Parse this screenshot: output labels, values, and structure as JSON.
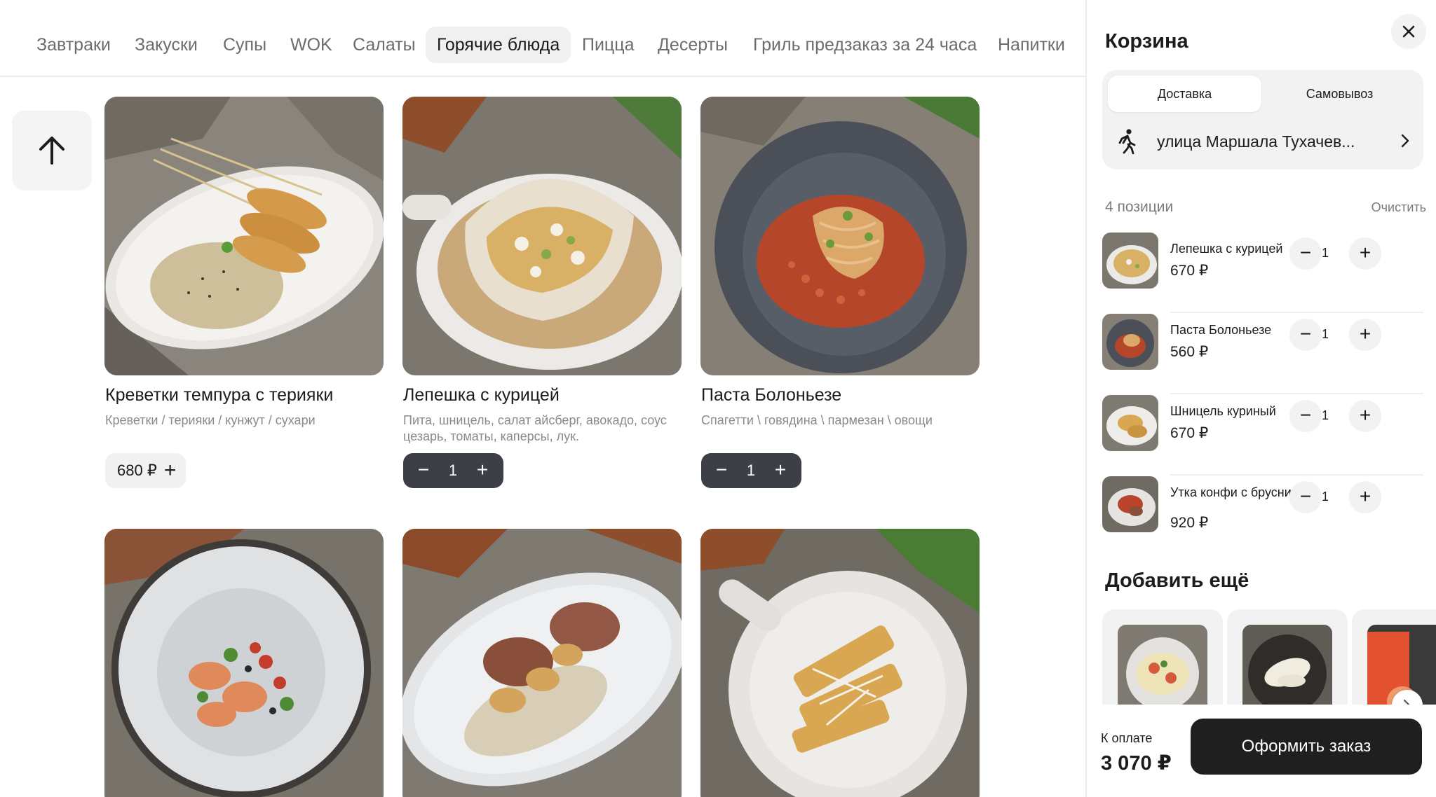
{
  "categories": [
    "Завтраки",
    "Закуски",
    "Супы",
    "WOK",
    "Салаты",
    "Горячие блюда",
    "Пицца",
    "Десерты",
    "Гриль предзаказ за 24 часа",
    "Напитки"
  ],
  "active_category": "Горячие блюда",
  "products": [
    {
      "title": "Креветки темпура с терияки",
      "description": "Креветки / терияки / кунжут / сухари",
      "price": "680 ₽",
      "in_cart": false
    },
    {
      "title": "Лепешка с курицей",
      "description": "Пита, шницель, салат айсберг, авокадо, соус цезарь, томаты, каперсы, лук.",
      "quantity": "1",
      "in_cart": true
    },
    {
      "title": "Паста Болоньезе",
      "description": "Спагетти \\ говядина \\ пармезан \\ овощи",
      "quantity": "1",
      "in_cart": true
    }
  ],
  "controls": {
    "minus": "−",
    "plus": "+"
  },
  "cart": {
    "title": "Корзина",
    "delivery_tabs": [
      "Доставка",
      "Самовывоз"
    ],
    "active_delivery": "Доставка",
    "address": "улица Маршала Тухачев...",
    "items_count": "4 позиции",
    "clear": "Очистить",
    "items": [
      {
        "name": "Лепешка с курицей",
        "price": "670 ₽",
        "quantity": "1"
      },
      {
        "name": "Паста Болоньезе",
        "price": "560 ₽",
        "quantity": "1"
      },
      {
        "name": "Шницель куриный",
        "price": "670 ₽",
        "quantity": "1"
      },
      {
        "name": "Утка конфи с брусникой",
        "price": "920 ₽",
        "quantity": "1"
      }
    ],
    "add_more": "Добавить ещё",
    "pay_label": "К оплате",
    "total": "3 070 ₽",
    "order_button": "Оформить заказ"
  },
  "icons": {
    "scroll_top": "arrow-up-icon",
    "close": "close-icon",
    "address": "walking-person-icon",
    "address_more": "chevron-right-icon",
    "suggestions_next": "chevron-right-icon"
  },
  "colors": {
    "dark_control": "#3c3f46",
    "order_button": "#1f1f1f",
    "panel_bg": "#f2f2f2"
  }
}
